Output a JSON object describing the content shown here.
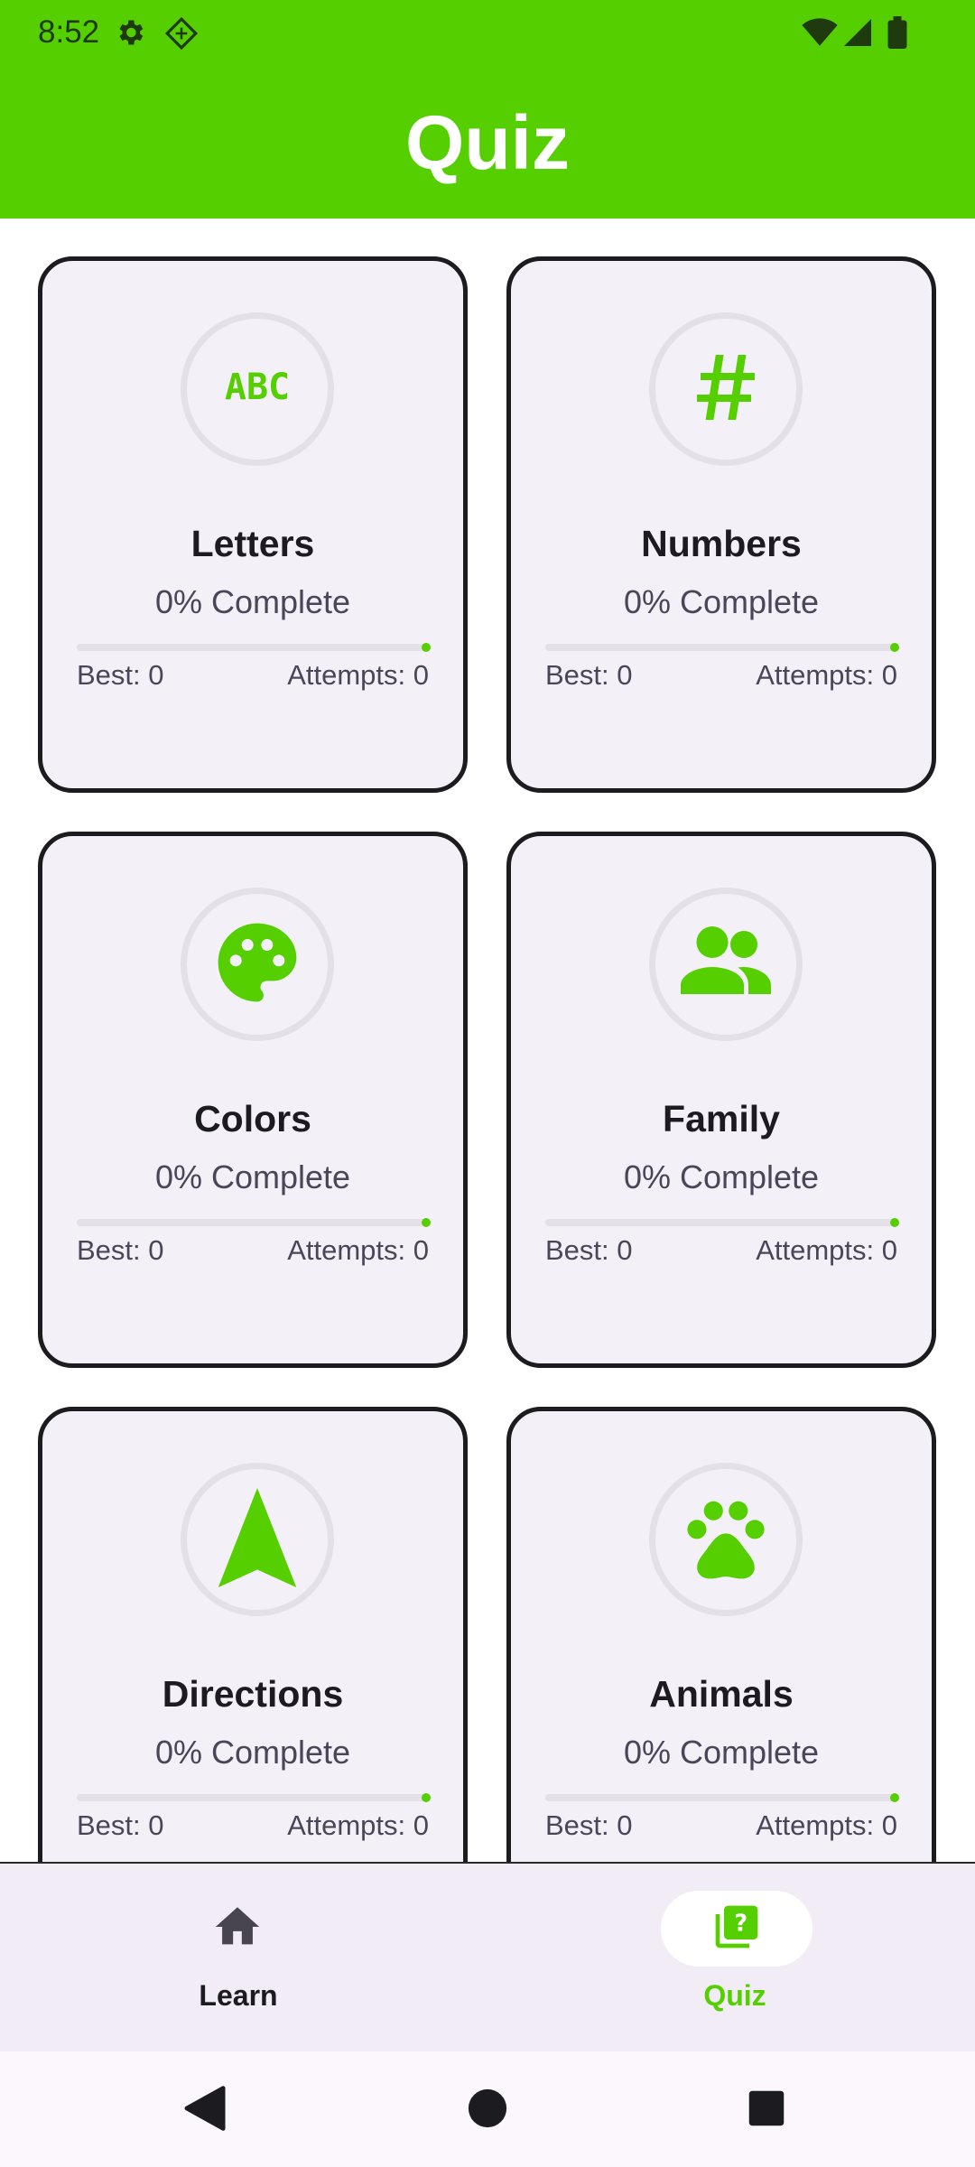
{
  "status_bar": {
    "time": "8:52"
  },
  "header": {
    "title": "Quiz"
  },
  "cards": [
    {
      "title": "Letters",
      "progress_text": "0% Complete",
      "progress": 0,
      "best": "Best: 0",
      "attempts": "Attempts: 0",
      "icon": "abc-icon"
    },
    {
      "title": "Numbers",
      "progress_text": "0% Complete",
      "progress": 0,
      "best": "Best: 0",
      "attempts": "Attempts: 0",
      "icon": "hash-icon"
    },
    {
      "title": "Colors",
      "progress_text": "0% Complete",
      "progress": 0,
      "best": "Best: 0",
      "attempts": "Attempts: 0",
      "icon": "palette-icon"
    },
    {
      "title": "Family",
      "progress_text": "0% Complete",
      "progress": 0,
      "best": "Best: 0",
      "attempts": "Attempts: 0",
      "icon": "people-icon"
    },
    {
      "title": "Directions",
      "progress_text": "0% Complete",
      "progress": 0,
      "best": "Best: 0",
      "attempts": "Attempts: 0",
      "icon": "navigation-arrow-icon"
    },
    {
      "title": "Animals",
      "progress_text": "0% Complete",
      "progress": 0,
      "best": "Best: 0",
      "attempts": "Attempts: 0",
      "icon": "paw-icon"
    }
  ],
  "bottom_nav": {
    "items": [
      {
        "label": "Learn",
        "icon": "home-icon",
        "selected": false
      },
      {
        "label": "Quiz",
        "icon": "quiz-icon",
        "selected": true
      }
    ]
  },
  "colors": {
    "accent": "#56CF00",
    "card_bg": "#F4F0F7",
    "card_border": "#1C1B1F",
    "nav_bg": "#F1ECF6"
  }
}
